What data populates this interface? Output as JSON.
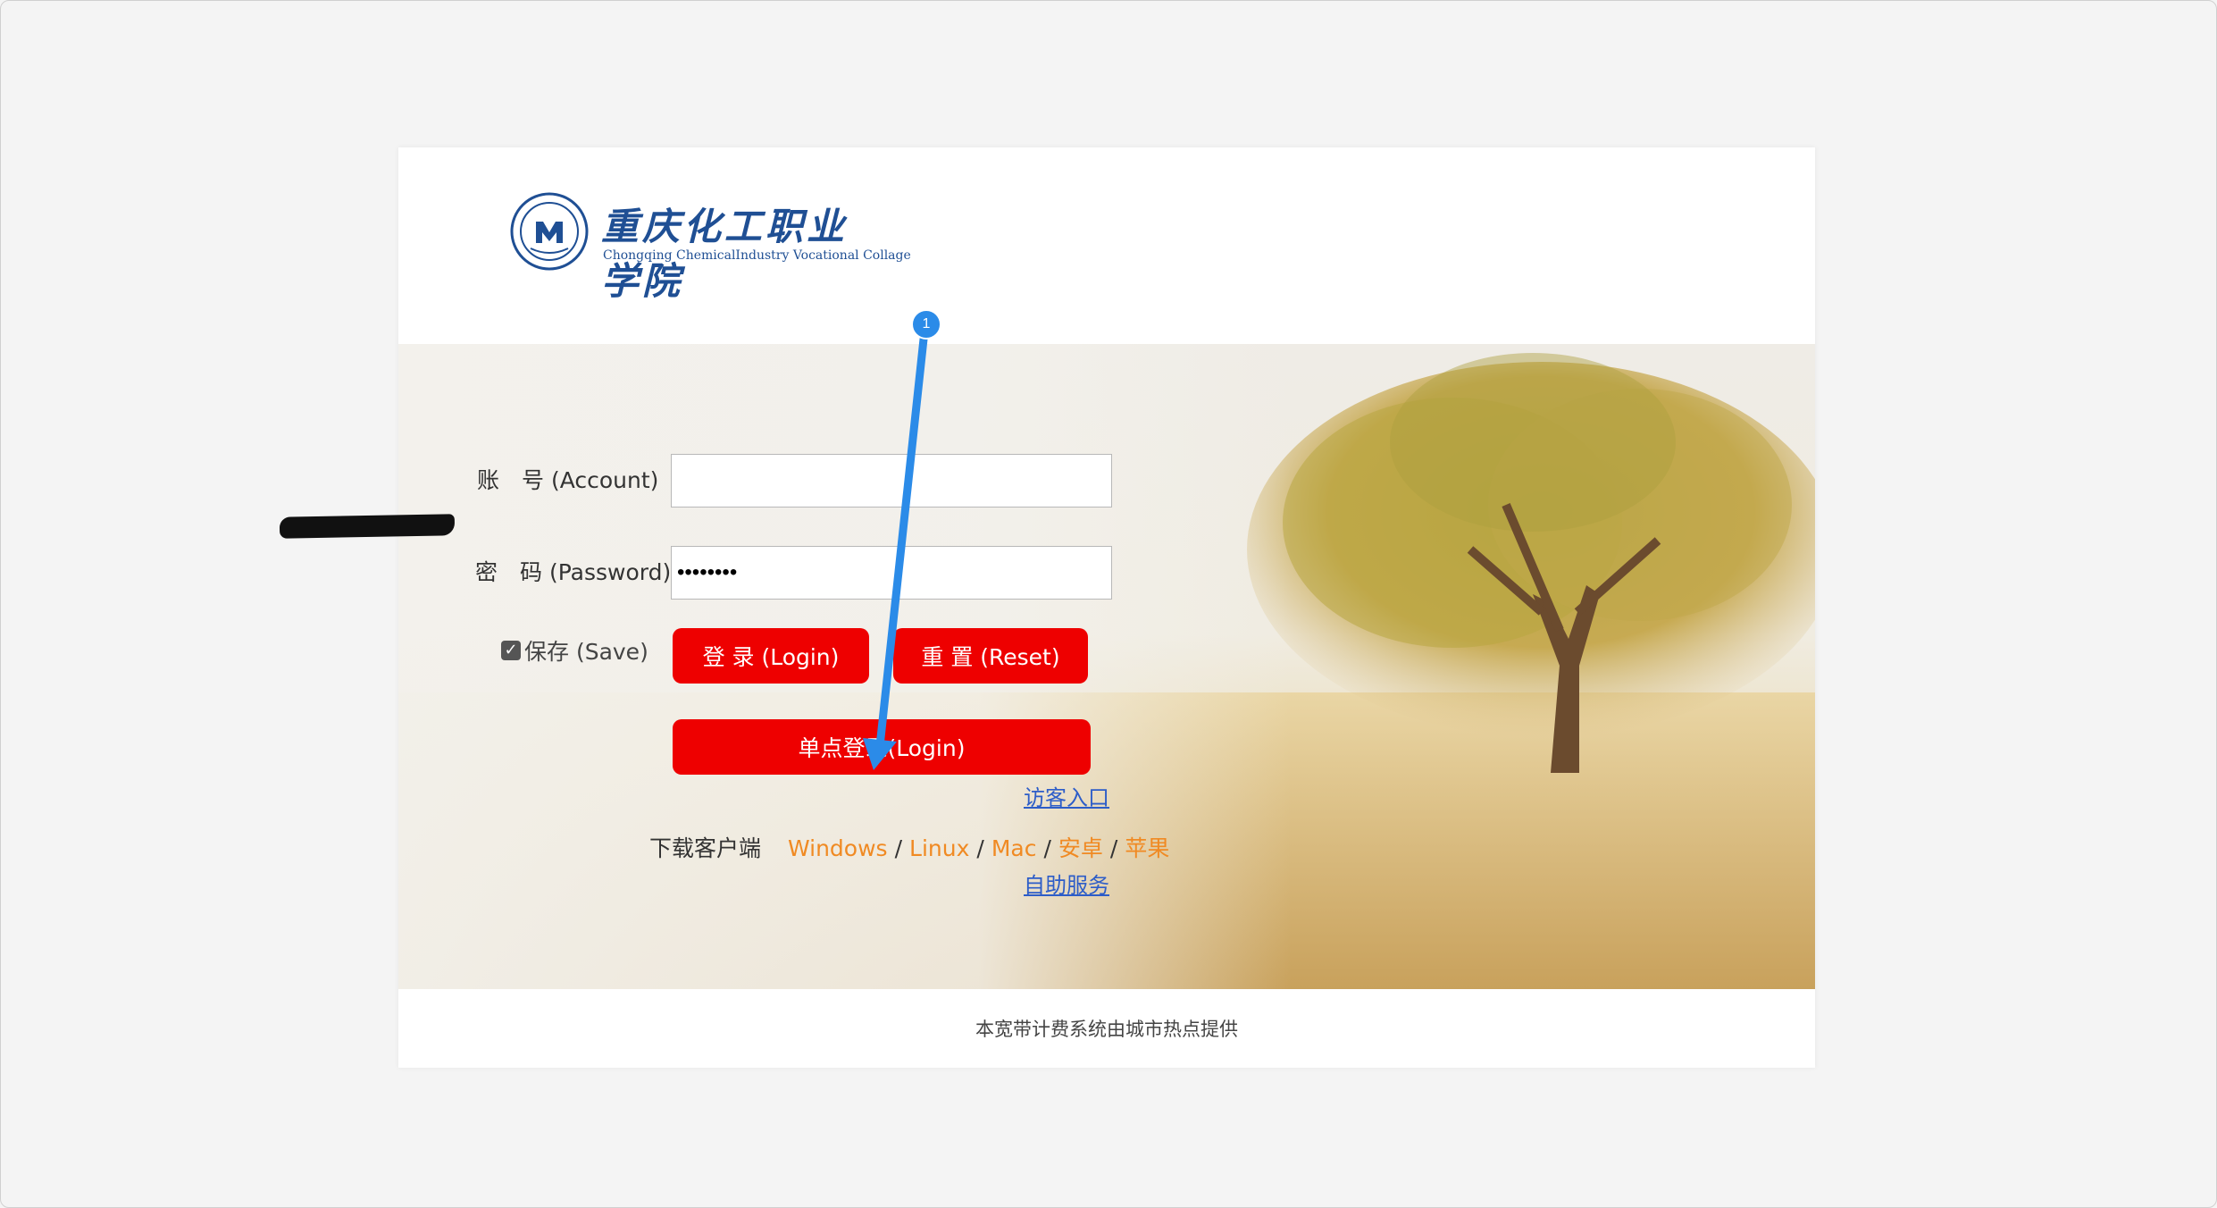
{
  "header": {
    "logo_title": "重庆化工职业学院",
    "logo_subtitle": "Chongqing ChemicalIndustry Vocational Collage"
  },
  "form": {
    "account_label": "账　号 (Account)",
    "account_value": "",
    "password_label": "密　码 (Password)",
    "password_value": "••••••••",
    "save_label": "保存 (Save)",
    "save_checked": true,
    "login_button": "登 录 (Login)",
    "reset_button": "重 置 (Reset)",
    "sso_button": "单点登录(Login)",
    "guest_link": "访客入口",
    "self_service_link": "自助服务"
  },
  "downloads": {
    "label": "下载客户端",
    "links": [
      "Windows",
      "Linux",
      "Mac",
      "安卓",
      "苹果"
    ],
    "separator": "/"
  },
  "footer": {
    "text": "本宽带计费系统由城市热点提供"
  },
  "annotation": {
    "step_number": "1",
    "color": "#2b8be8"
  },
  "colors": {
    "button_red": "#ee0000",
    "download_link_orange": "#f08a23",
    "link_blue": "#2d5dc8"
  }
}
